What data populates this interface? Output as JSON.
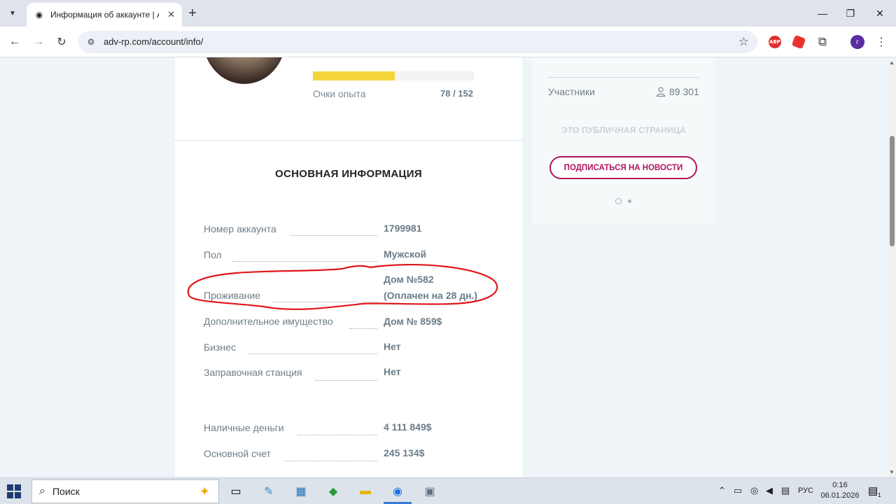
{
  "browser": {
    "tab_title": "Информация об аккаунте | Ad",
    "url": "adv-rp.com/account/info/",
    "profile_initial": "г",
    "abp_label": "ABP"
  },
  "profile": {
    "xp_label": "Очки опыта",
    "xp_value": "78 / 152",
    "xp_fraction": 0.51
  },
  "section": {
    "title": "ОСНОВНАЯ ИНФОРМАЦИЯ"
  },
  "info": [
    {
      "label": "Номер аккаунта",
      "value": "1799981"
    },
    {
      "label": "Пол",
      "value": "Мужской"
    },
    {
      "label": "Проживание",
      "value_line1": "Дом №582",
      "value_line2": "(Оплачен на 28 дн.)"
    },
    {
      "label": "Дополнительное имущество",
      "value": "Дом № 859$"
    },
    {
      "label": "Бизнес",
      "value": "Нет"
    },
    {
      "label": "Заправочная станция",
      "value": "Нет"
    },
    {
      "label": "Наличные деньги",
      "value": "4 111 849$"
    },
    {
      "label": "Основной счет",
      "value": "245 134$"
    }
  ],
  "sidebar": {
    "members_label": "Участники",
    "members_value": "89 301",
    "public_label": "ЭТО ПУБЛИЧНАЯ СТРАНИЦА",
    "subscribe_label": "ПОДПИСАТЬСЯ НА НОВОСТИ"
  },
  "taskbar": {
    "search_placeholder": "Поиск",
    "lang": "РУС",
    "time": "0:16",
    "date": "06.01.2026",
    "notif_count": "1"
  },
  "colors": {
    "accent": "#b3135d",
    "xp_fill": "#f5d43b",
    "annotation": "#e0161d"
  }
}
